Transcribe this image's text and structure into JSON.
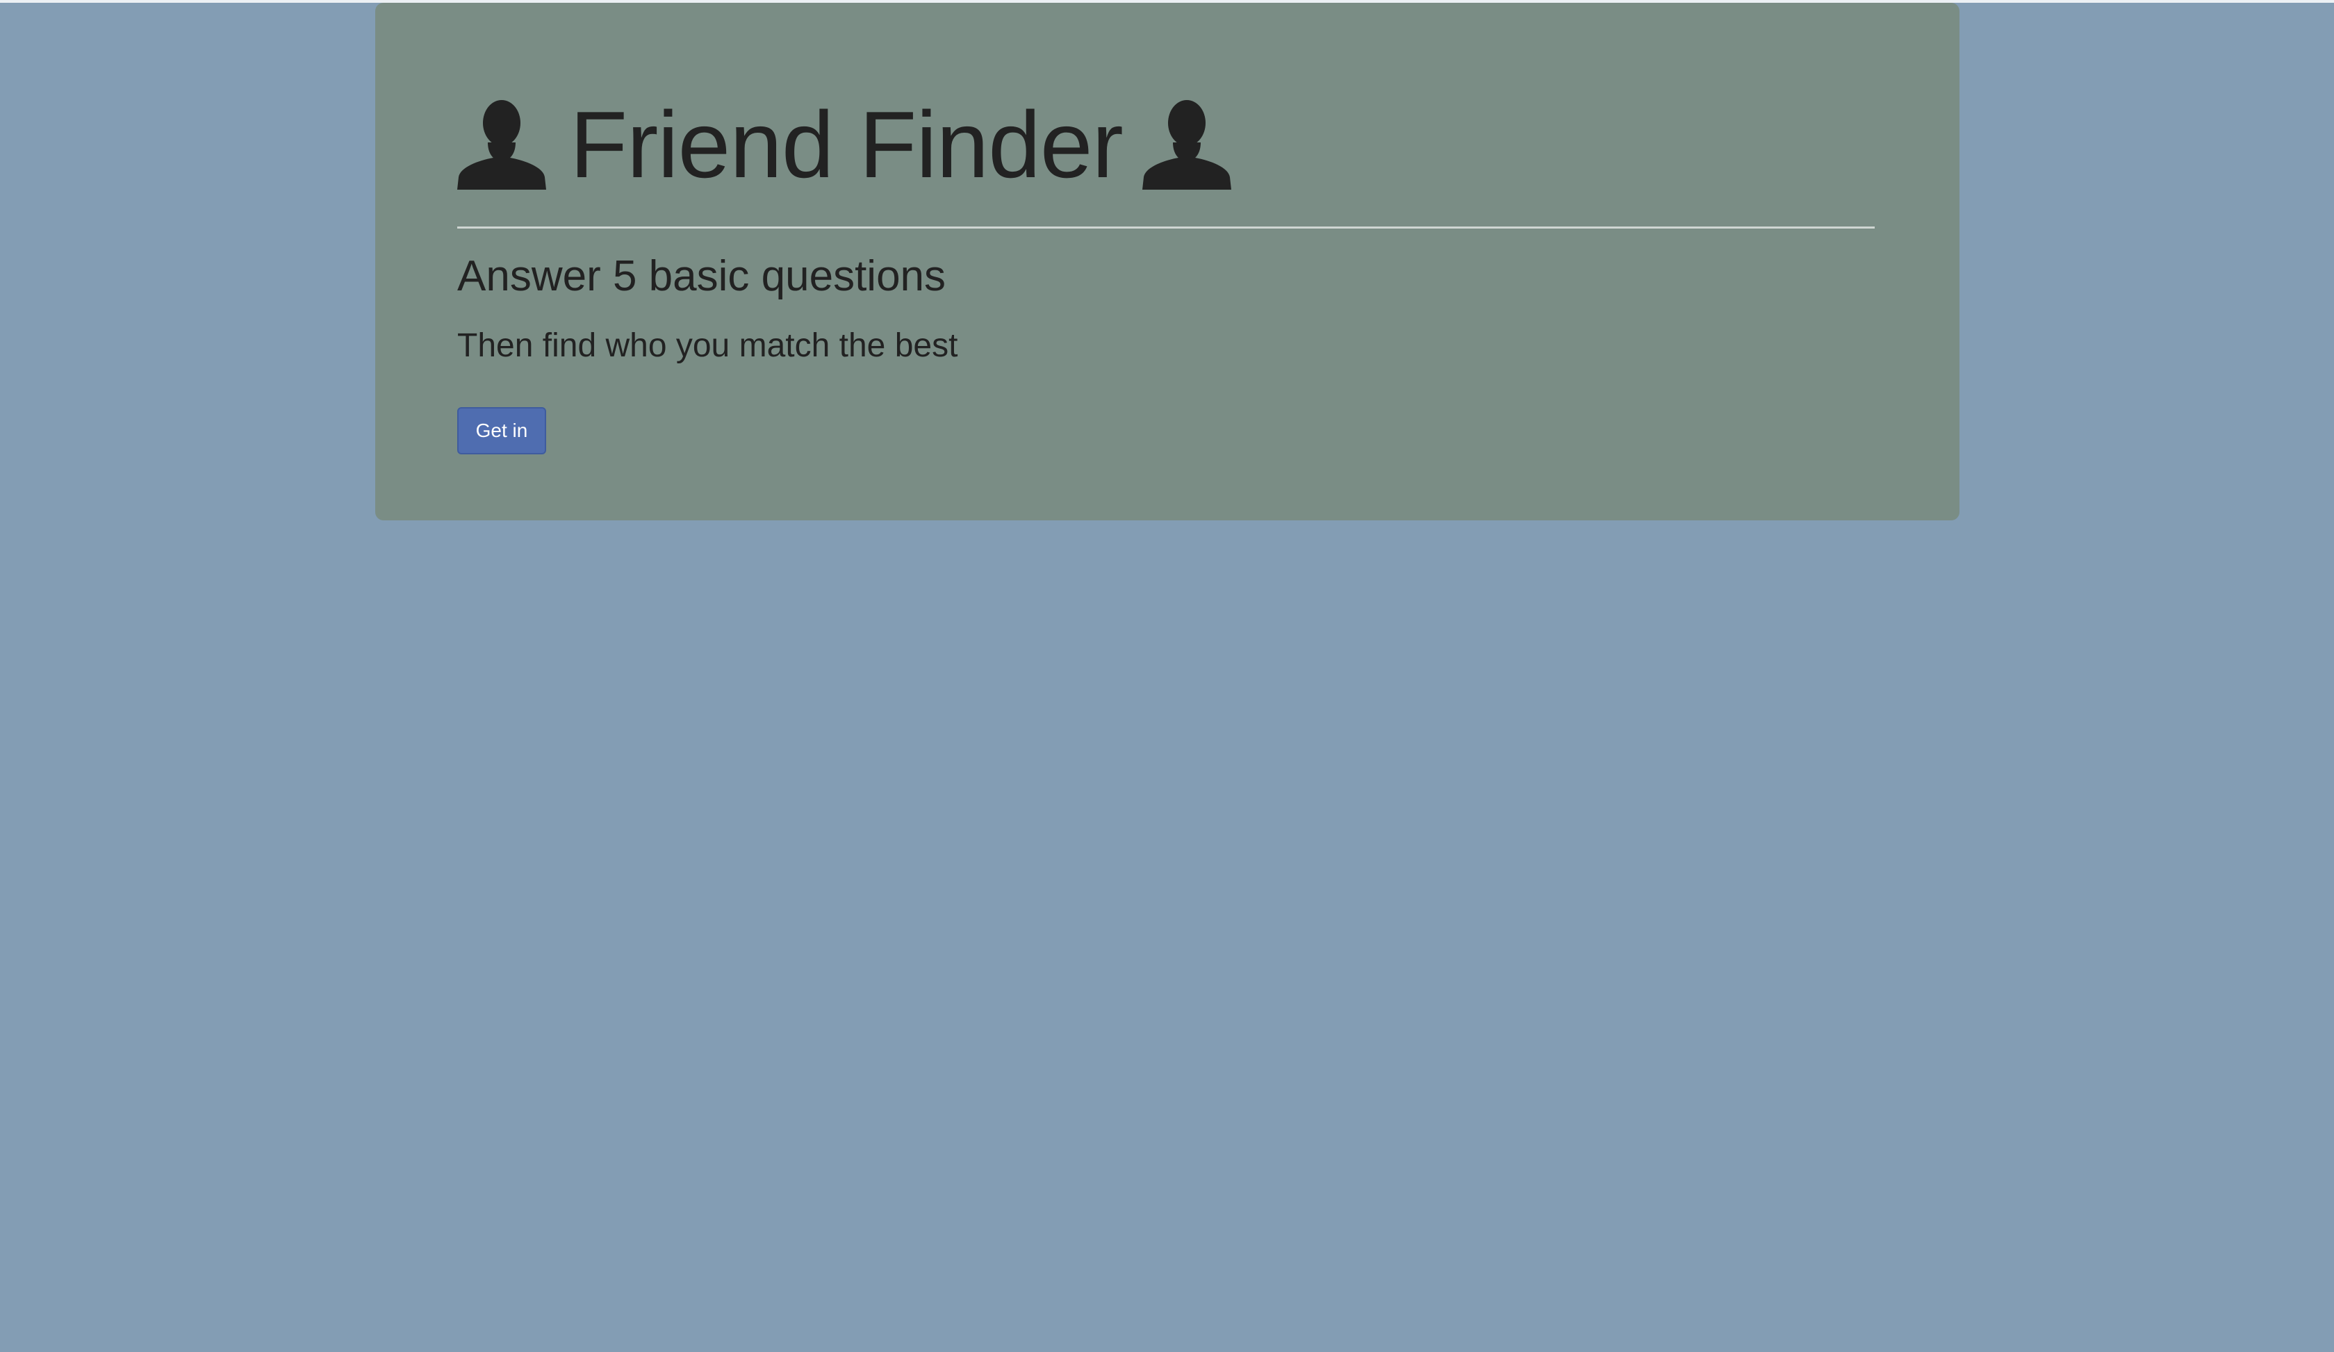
{
  "hero": {
    "title": "Friend Finder",
    "subtitle": "Answer 5 basic questions",
    "lead": "Then find who you match the best",
    "button_label": "Get in",
    "icon_left": "person-icon",
    "icon_right": "person-icon"
  },
  "colors": {
    "page_background": "#839db4",
    "jumbotron_background": "#7a8d85",
    "button_background": "#4f6db0",
    "text": "#222222"
  }
}
